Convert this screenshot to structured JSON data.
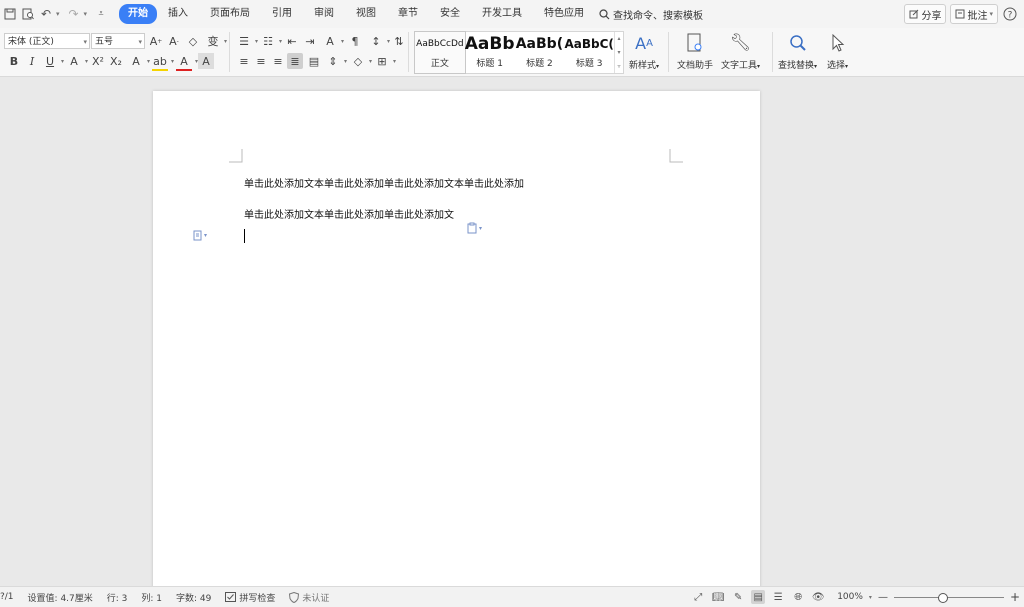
{
  "menubar": {
    "items": [
      {
        "label": "开始",
        "active": true
      },
      {
        "label": "插入"
      },
      {
        "label": "页面布局"
      },
      {
        "label": "引用"
      },
      {
        "label": "审阅"
      },
      {
        "label": "视图"
      },
      {
        "label": "章节"
      },
      {
        "label": "安全"
      },
      {
        "label": "开发工具"
      },
      {
        "label": "特色应用"
      }
    ],
    "search_label": "查找命令、搜索模板",
    "share_label": "分享",
    "comment_label": "批注",
    "help_icon": "help-icon",
    "active_color": "#3a7ff6"
  },
  "ribbon": {
    "font_name": "宋体 (正文)",
    "font_size": "五号",
    "styles": [
      {
        "preview": "AaBbCcDd",
        "label": "正文"
      },
      {
        "preview": "AaBb",
        "label": "标题 1"
      },
      {
        "preview": "AaBb(",
        "label": "标题 2"
      },
      {
        "preview": "AaBbC(",
        "label": "标题 3"
      }
    ],
    "new_style_label": "新样式",
    "doc_helper_label": "文档助手",
    "text_tools_label": "文字工具",
    "find_replace_label": "查找替换",
    "select_label": "选择"
  },
  "document": {
    "paragraphs": [
      "单击此处添加文本单击此处添加单击此处添加文本单击此处添加",
      "单击此处添加文本单击此处添加单击此处添加文"
    ]
  },
  "statusbar": {
    "page": "?/1",
    "setting": "设置值: 4.7厘米",
    "row": "行: 3",
    "col": "列: 1",
    "word_count": "字数: 49",
    "spell_check": "拼写检查",
    "certification": "未认证",
    "zoom": "100%",
    "zoom_minus": "—",
    "zoom_plus": "+",
    "zoom_level_fraction": 0.45
  }
}
